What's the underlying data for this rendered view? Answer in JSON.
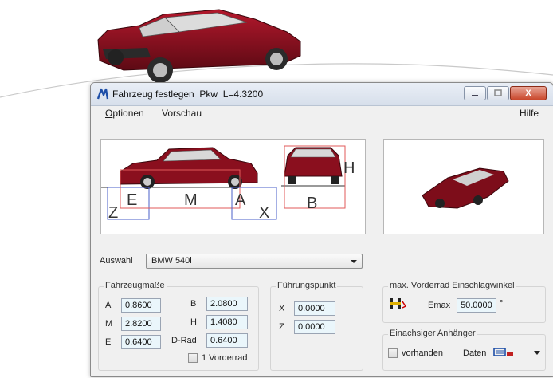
{
  "window": {
    "title": "Fahrzeug festlegen  Pkw  L=4.3200",
    "minimize_icon": "minimize-icon",
    "maximize_icon": "maximize-icon",
    "close_glyph": "X"
  },
  "menu": {
    "items": [
      {
        "label": "Optionen",
        "underline": "O",
        "rest": "ptionen"
      },
      {
        "label": "Vorschau"
      }
    ],
    "help": "Hilfe"
  },
  "diagram": {
    "labels": {
      "z": "Z",
      "e": "E",
      "m": "M",
      "a": "A",
      "x": "X",
      "b": "B",
      "h": "H"
    }
  },
  "auswahl": {
    "label": "Auswahl",
    "value": "BMW 540i"
  },
  "fahrzeugmasse": {
    "title": "Fahrzeugmaße",
    "a_label": "A",
    "a_value": "0.8600",
    "m_label": "M",
    "m_value": "2.8200",
    "e_label": "E",
    "e_value": "0.6400",
    "b_label": "B",
    "b_value": "2.0800",
    "h_label": "H",
    "h_value": "1.4080",
    "drad_label": "D-Rad",
    "drad_value": "0.6400",
    "vorderrad_label": "1 Vorderrad"
  },
  "fuehrungspunkt": {
    "title": "Führungspunkt",
    "x_label": "X",
    "x_value": "0.0000",
    "z_label": "Z",
    "z_value": "0.0000"
  },
  "einschlag": {
    "title": "max. Vorderrad Einschlagwinkel",
    "emax_label": "Emax",
    "emax_value": "50.0000",
    "unit": "°"
  },
  "anhaenger": {
    "title": "Einachsiger Anhänger",
    "vorhanden_label": "vorhanden",
    "daten_label": "Daten"
  },
  "colors": {
    "car_red": "#8a0f1e",
    "dim_red": "#e05a5a",
    "dim_blue": "#4a5fc8",
    "accent_blue": "#1e4fa8"
  }
}
